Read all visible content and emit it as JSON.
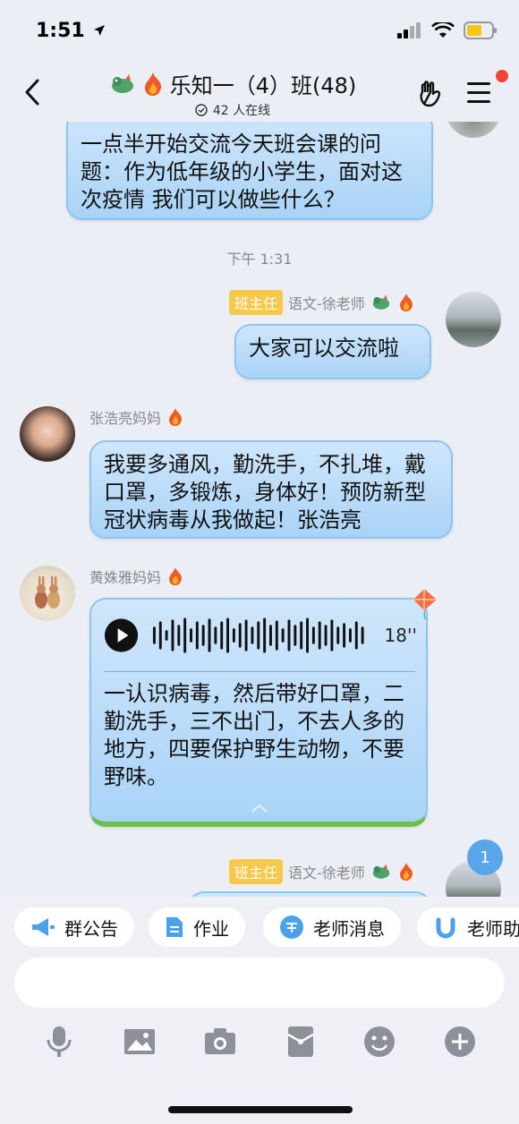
{
  "status_bar": {
    "time": "1:51"
  },
  "header": {
    "title": "乐知一（4）班(48)",
    "online": "42 人在线"
  },
  "messages": [
    {
      "text": "一点半开始交流今天班会课的问题：作为低年级的小学生，面对这次疫情 我们可以做些什么？"
    },
    {
      "time": "下午 1:31"
    },
    {
      "role": "班主任",
      "sender": "语文-徐老师",
      "text": "大家可以交流啦"
    },
    {
      "sender": "张浩亮妈妈",
      "text": "我要多通风，勤洗手，不扎堆，戴口罩，多锻炼，身体好！预防新型冠状病毒从我做起！张浩亮"
    },
    {
      "sender": "黄姝雅妈妈",
      "voice_duration": "18''",
      "text": "一认识病毒，然后带好口罩，二勤洗手，三不出门，不去人多的地方，四要保护野生动物，不要野味。"
    },
    {
      "role": "班主任",
      "sender": "语文-徐老师"
    }
  ],
  "unread_count": "1",
  "quick_actions": [
    {
      "label": "群公告",
      "icon": "megaphone-icon"
    },
    {
      "label": "作业",
      "icon": "document-icon"
    },
    {
      "label": "老师消息",
      "icon": "teacher-icon"
    },
    {
      "label": "老师助",
      "icon": "assistant-icon"
    }
  ],
  "toolbar_icons": [
    "microphone-icon",
    "image-icon",
    "camera-icon",
    "red-packet-icon",
    "emoji-icon",
    "plus-icon"
  ],
  "colors": {
    "bubble": "#a9d3f6",
    "badge": "#f7c94a",
    "accent": "#5aa6ea",
    "badge_red": "#f44336"
  }
}
